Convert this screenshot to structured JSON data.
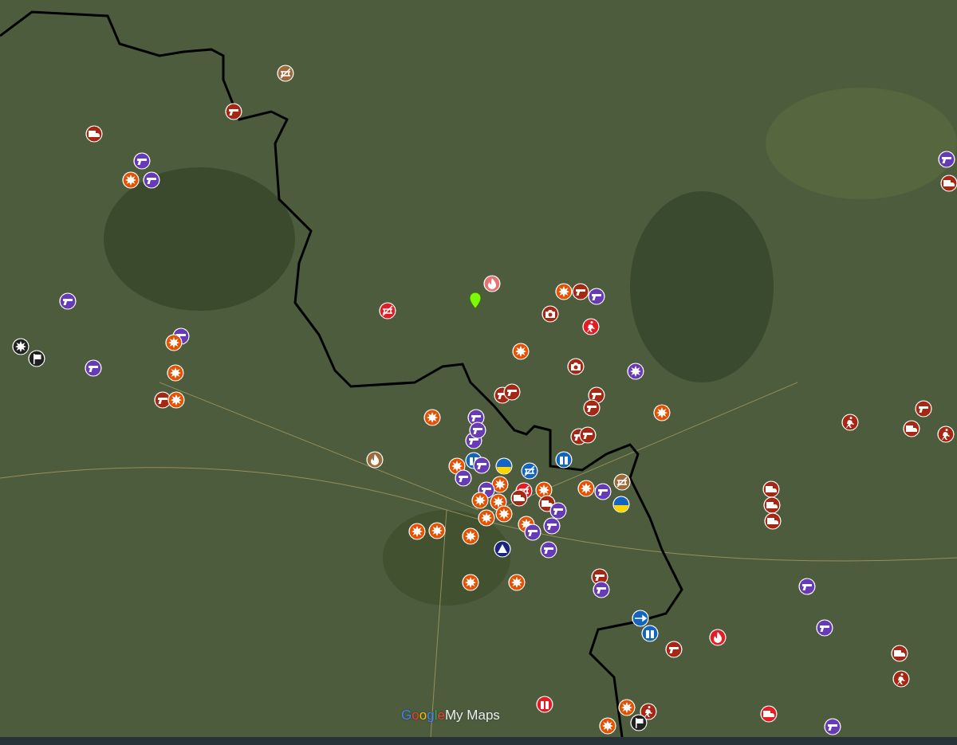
{
  "map": {
    "logo": {
      "brand": "Google",
      "product": "My Maps"
    },
    "markers": [
      {
        "kind": "nobridge",
        "color": "#9c6b3c"
      },
      {
        "kind": "gun",
        "color": "#a52714"
      },
      {
        "kind": "truck",
        "color": "#a52714"
      },
      {
        "kind": "gun",
        "color": "#673ab7"
      },
      {
        "kind": "burst",
        "color": "#e65100"
      },
      {
        "kind": "gun",
        "color": "#673ab7"
      },
      {
        "kind": "gun",
        "color": "#673ab7"
      },
      {
        "kind": "nobridge",
        "color": "#e51c23"
      },
      {
        "kind": "fire",
        "color": "#e57373"
      },
      {
        "kind": "burst",
        "color": "#e65100"
      },
      {
        "kind": "gun",
        "color": "#a52714"
      },
      {
        "kind": "gun",
        "color": "#673ab7"
      },
      {
        "kind": "camera",
        "color": "#a52714"
      },
      {
        "kind": "run",
        "color": "#e51c23"
      },
      {
        "kind": "gun",
        "color": "#673ab7"
      },
      {
        "kind": "burst",
        "color": "#e65100"
      },
      {
        "kind": "burst",
        "color": "#212121"
      },
      {
        "kind": "flag",
        "color": "#212121"
      },
      {
        "kind": "gun",
        "color": "#673ab7"
      },
      {
        "kind": "burst",
        "color": "#e65100"
      },
      {
        "kind": "gun",
        "color": "#a52714"
      },
      {
        "kind": "burst",
        "color": "#e65100"
      },
      {
        "kind": "burst",
        "color": "#e65100"
      },
      {
        "kind": "camera",
        "color": "#a52714"
      },
      {
        "kind": "burst",
        "color": "#673ab7"
      },
      {
        "kind": "gun",
        "color": "#a52714"
      },
      {
        "kind": "gun",
        "color": "#a52714"
      },
      {
        "kind": "gun",
        "color": "#a52714"
      },
      {
        "kind": "gun",
        "color": "#a52714"
      },
      {
        "kind": "burst",
        "color": "#e65100"
      },
      {
        "kind": "gun",
        "color": "#673ab7"
      },
      {
        "kind": "gun",
        "color": "#673ab7"
      },
      {
        "kind": "gun",
        "color": "#673ab7"
      },
      {
        "kind": "burst",
        "color": "#e65100"
      },
      {
        "kind": "gun",
        "color": "#a52714"
      },
      {
        "kind": "gun",
        "color": "#a52714"
      },
      {
        "kind": "fire",
        "color": "#9c6b3c"
      },
      {
        "kind": "cylinder",
        "color": "#1565c0"
      },
      {
        "kind": "burst",
        "color": "#e65100"
      },
      {
        "kind": "gun",
        "color": "#673ab7"
      },
      {
        "kind": "gun",
        "color": "#673ab7"
      },
      {
        "kind": "ukraine",
        "color": "#1565c0"
      },
      {
        "kind": "nobridge",
        "color": "#1565c0"
      },
      {
        "kind": "cylinder",
        "color": "#1565c0"
      },
      {
        "kind": "burst",
        "color": "#e65100"
      },
      {
        "kind": "gun",
        "color": "#673ab7"
      },
      {
        "kind": "nobridge",
        "color": "#e51c23"
      },
      {
        "kind": "burst",
        "color": "#e65100"
      },
      {
        "kind": "burst",
        "color": "#e65100"
      },
      {
        "kind": "burst",
        "color": "#e65100"
      },
      {
        "kind": "truck",
        "color": "#a52714"
      },
      {
        "kind": "truck",
        "color": "#a52714"
      },
      {
        "kind": "burst",
        "color": "#e65100"
      },
      {
        "kind": "burst",
        "color": "#e65100"
      },
      {
        "kind": "burst",
        "color": "#e65100"
      },
      {
        "kind": "gun",
        "color": "#673ab7"
      },
      {
        "kind": "gun",
        "color": "#673ab7"
      },
      {
        "kind": "gun",
        "color": "#673ab7"
      },
      {
        "kind": "burst",
        "color": "#e65100"
      },
      {
        "kind": "burst",
        "color": "#e65100"
      },
      {
        "kind": "burst",
        "color": "#e65100"
      },
      {
        "kind": "warning",
        "color": "#1a237e"
      },
      {
        "kind": "gun",
        "color": "#673ab7"
      },
      {
        "kind": "burst",
        "color": "#e65100"
      },
      {
        "kind": "gun",
        "color": "#673ab7"
      },
      {
        "kind": "nobridge",
        "color": "#9c6b3c"
      },
      {
        "kind": "ukraine",
        "color": "#1565c0"
      },
      {
        "kind": "burst",
        "color": "#e65100"
      },
      {
        "kind": "burst",
        "color": "#e65100"
      },
      {
        "kind": "gun",
        "color": "#a52714"
      },
      {
        "kind": "gun",
        "color": "#673ab7"
      },
      {
        "kind": "arrow",
        "color": "#1565c0"
      },
      {
        "kind": "cylinder",
        "color": "#1565c0"
      },
      {
        "kind": "gun",
        "color": "#a52714"
      },
      {
        "kind": "fire",
        "color": "#e51c23"
      },
      {
        "kind": "gun",
        "color": "#673ab7"
      },
      {
        "kind": "gun",
        "color": "#673ab7"
      },
      {
        "kind": "run",
        "color": "#a52714"
      },
      {
        "kind": "truck",
        "color": "#a52714"
      },
      {
        "kind": "gun",
        "color": "#a52714"
      },
      {
        "kind": "run",
        "color": "#a52714"
      },
      {
        "kind": "truck",
        "color": "#a52714"
      },
      {
        "kind": "truck",
        "color": "#a52714"
      },
      {
        "kind": "truck",
        "color": "#a52714"
      },
      {
        "kind": "gun",
        "color": "#673ab7"
      },
      {
        "kind": "truck",
        "color": "#a52714"
      },
      {
        "kind": "truck",
        "color": "#a52714"
      },
      {
        "kind": "run",
        "color": "#a52714"
      },
      {
        "kind": "cylinder",
        "color": "#e51c23"
      },
      {
        "kind": "burst",
        "color": "#e65100"
      },
      {
        "kind": "burst",
        "color": "#e65100"
      },
      {
        "kind": "run",
        "color": "#a52714"
      },
      {
        "kind": "flag",
        "color": "#212121"
      },
      {
        "kind": "truck",
        "color": "#e51c23"
      },
      {
        "kind": "gun",
        "color": "#673ab7"
      },
      {
        "kind": "pin",
        "color": "#7cfc00"
      }
    ]
  }
}
